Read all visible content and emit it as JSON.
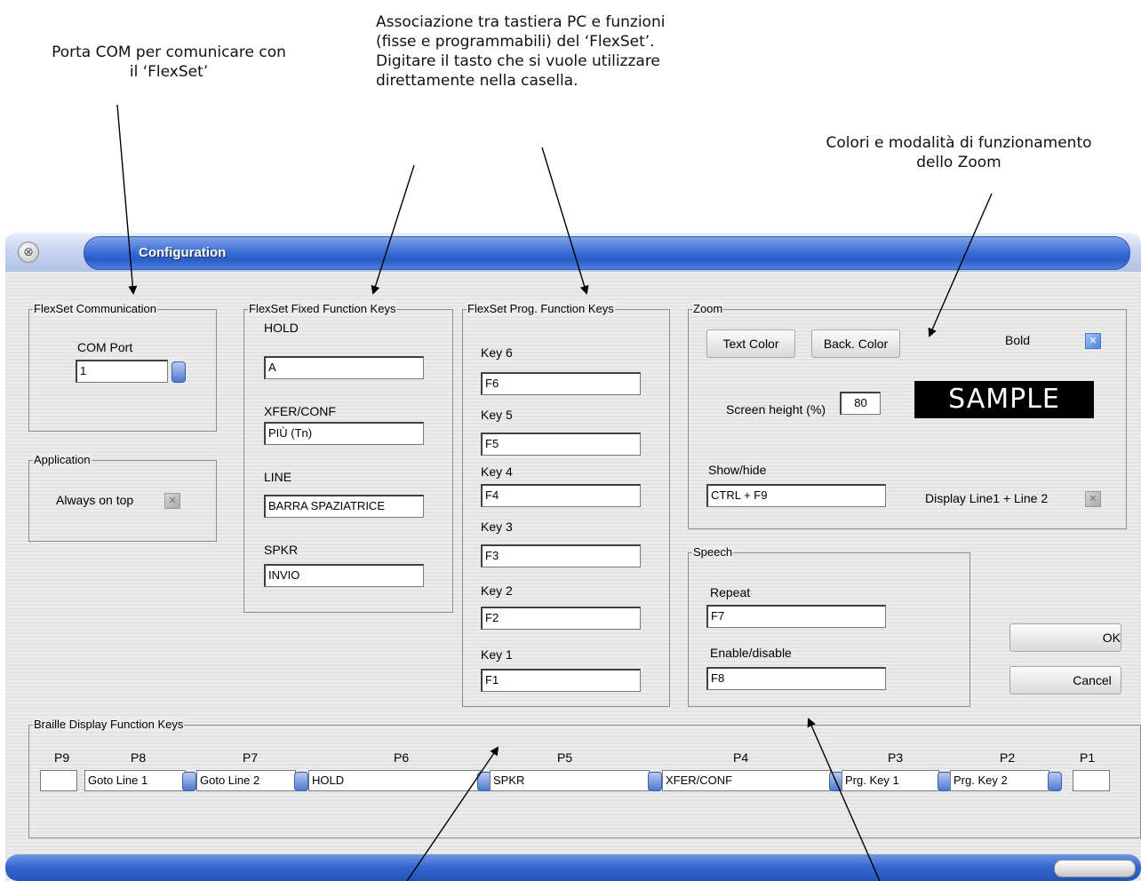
{
  "annotations": {
    "com_port_note": [
      "Porta COM per comunicare con",
      "il ‘FlexSet’"
    ],
    "keys_note": [
      "Associazione tra tastiera PC e funzioni",
      "(fisse e programmabili) del ‘FlexSet’.",
      "Digitare il tasto che si vuole utilizzare",
      "direttamente nella casella."
    ],
    "zoom_note": [
      "Colori e modalità di funzionamento",
      "dello Zoom"
    ]
  },
  "window": {
    "title": "Configuration"
  },
  "communication": {
    "group_label": "FlexSet Communication",
    "com_port_label": "COM Port",
    "com_port_value": "1"
  },
  "application": {
    "group_label": "Application",
    "always_on_top_label": "Always on top",
    "always_on_top_checked": false
  },
  "fixed_keys": {
    "group_label": "FlexSet Fixed Function Keys",
    "items": [
      {
        "label": "HOLD",
        "value": "A"
      },
      {
        "label": "XFER/CONF",
        "value": "PIÙ (Tn)"
      },
      {
        "label": "LINE",
        "value": "BARRA SPAZIATRICE"
      },
      {
        "label": "SPKR",
        "value": "INVIO"
      }
    ]
  },
  "prog_keys": {
    "group_label": "FlexSet Prog. Function Keys",
    "items": [
      {
        "label": "Key 6",
        "value": "F6"
      },
      {
        "label": "Key 5",
        "value": "F5"
      },
      {
        "label": "Key 4",
        "value": "F4"
      },
      {
        "label": "Key 3",
        "value": "F3"
      },
      {
        "label": "Key 2",
        "value": "F2"
      },
      {
        "label": "Key 1",
        "value": "F1"
      }
    ]
  },
  "zoom": {
    "group_label": "Zoom",
    "text_color_button": "Text Color",
    "back_color_button": "Back. Color",
    "bold_label": "Bold",
    "bold_checked": true,
    "screen_height_label": "Screen height (%)",
    "screen_height_value": "80",
    "sample_text": "SAMPLE",
    "show_hide_label": "Show/hide",
    "show_hide_value": "CTRL + F9",
    "display_lines_label": "Display Line1 + Line 2",
    "display_lines_checked": false
  },
  "speech": {
    "group_label": "Speech",
    "repeat_label": "Repeat",
    "repeat_value": "F7",
    "enable_label": "Enable/disable",
    "enable_value": "F8"
  },
  "buttons": {
    "ok": "OK",
    "cancel": "Cancel"
  },
  "braille": {
    "group_label": "Braille Display Function Keys",
    "keys": [
      {
        "label": "P9",
        "value": ""
      },
      {
        "label": "P8",
        "value": "Goto Line 1"
      },
      {
        "label": "P7",
        "value": "Goto Line 2"
      },
      {
        "label": "P6",
        "value": "HOLD"
      },
      {
        "label": "P5",
        "value": "SPKR"
      },
      {
        "label": "P4",
        "value": "XFER/CONF"
      },
      {
        "label": "P3",
        "value": "Prg. Key 1"
      },
      {
        "label": "P2",
        "value": "Prg. Key 2"
      },
      {
        "label": "P1",
        "value": ""
      }
    ]
  },
  "colors": {
    "title_blue": "#3e6fd9",
    "window_bg": "#ececec",
    "sample_bg": "#000000",
    "sample_fg": "#ffffff"
  }
}
